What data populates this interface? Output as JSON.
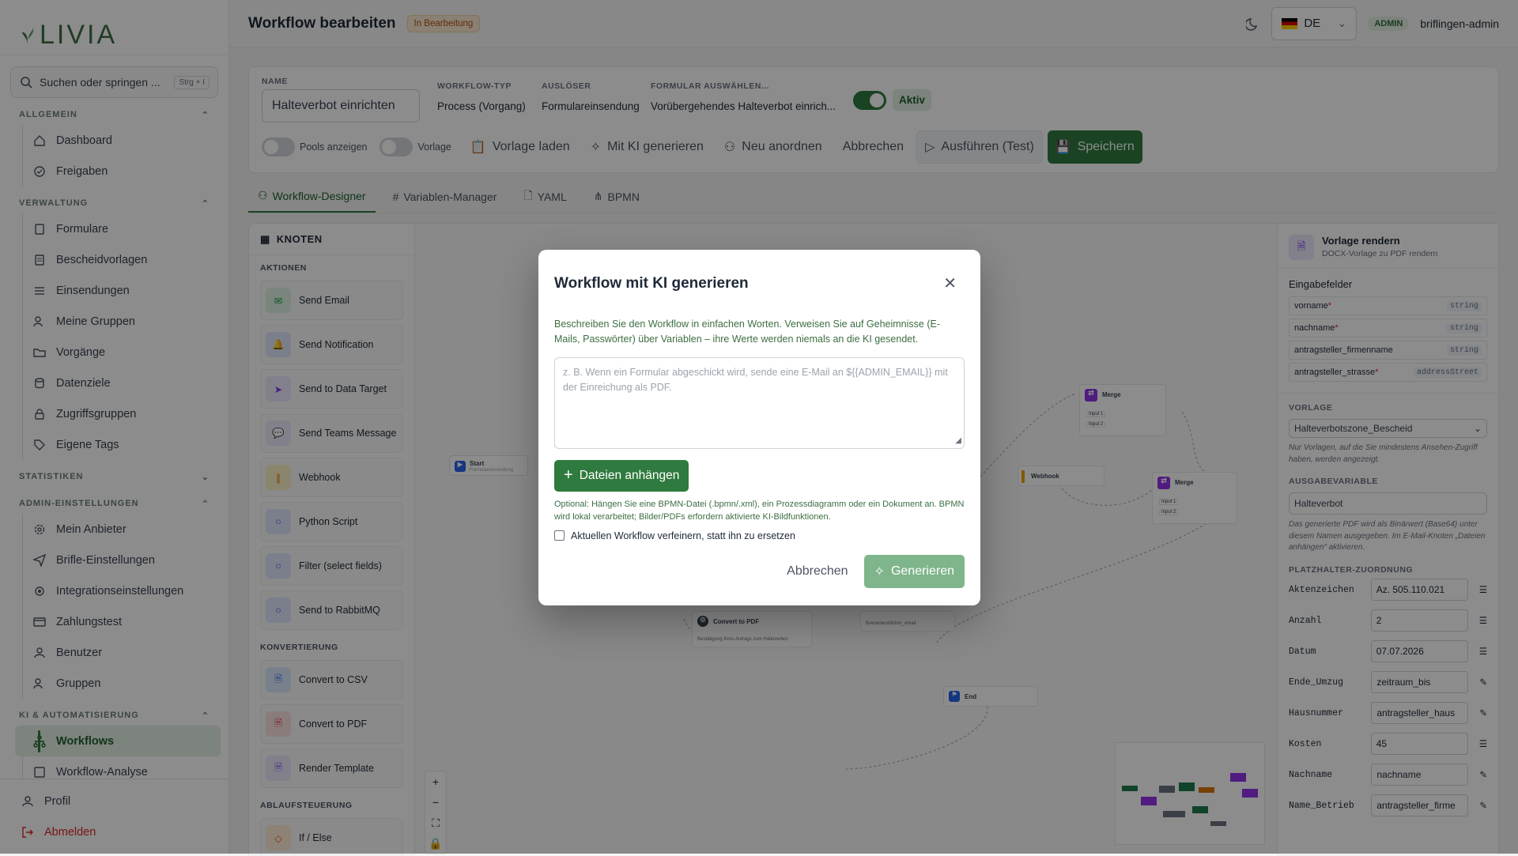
{
  "app": {
    "logo_text": "LIVIA"
  },
  "search": {
    "placeholder": "Suchen oder springen ...",
    "shortcut": "Strg + I"
  },
  "sidebar": {
    "sections": [
      {
        "title": "ALLGEMEIN",
        "items": [
          "Dashboard",
          "Freigaben"
        ]
      },
      {
        "title": "VERWALTUNG",
        "items": [
          "Formulare",
          "Bescheidvorlagen",
          "Einsendungen",
          "Meine Gruppen",
          "Vorgänge",
          "Datenziele",
          "Zugriffsgruppen",
          "Eigene Tags"
        ]
      },
      {
        "title": "STATISTIKEN",
        "items": []
      },
      {
        "title": "ADMIN-EINSTELLUNGEN",
        "items": [
          "Mein Anbieter",
          "Brifle-Einstellungen",
          "Integrationseinstellungen",
          "Zahlungstest",
          "Benutzer",
          "Gruppen"
        ]
      },
      {
        "title": "KI & AUTOMATISIERUNG",
        "items": [
          "Workflows",
          "Workflow-Analyse"
        ]
      }
    ],
    "profile": "Profil",
    "logout": "Abmelden"
  },
  "header": {
    "title": "Workflow bearbeiten",
    "status": "In Bearbeitung",
    "lang": "DE",
    "role": "ADMIN",
    "user": "briflingen-admin"
  },
  "form": {
    "name_label": "NAME",
    "name_value": "Halteverbot einrichten",
    "type_label": "WORKFLOW-TYP",
    "type_value": "Process (Vorgang)",
    "trigger_label": "AUSLÖSER",
    "trigger_value": "Formulareinsendung",
    "form_label": "FORMULAR AUSWÄHLEN...",
    "form_value": "Vorübergehendes Halteverbot einrich...",
    "active_label": "Aktiv",
    "pools_label": "Pools anzeigen",
    "template_label": "Vorlage",
    "btn_load": "Vorlage laden",
    "btn_ai": "Mit KI generieren",
    "btn_arrange": "Neu anordnen",
    "btn_cancel": "Abbrechen",
    "btn_run": "Ausführen (Test)",
    "btn_save": "Speichern"
  },
  "tabs": [
    "Workflow-Designer",
    "Variablen-Manager",
    "YAML",
    "BPMN"
  ],
  "knoten": {
    "title": "KNOTEN",
    "sections": [
      {
        "title": "AKTIONEN",
        "items": [
          "Send Email",
          "Send Notification",
          "Send to Data Target",
          "Send Teams Message",
          "Webhook",
          "Python Script",
          "Filter (select fields)",
          "Send to RabbitMQ"
        ]
      },
      {
        "title": "KONVERTIERUNG",
        "items": [
          "Convert to CSV",
          "Convert to PDF",
          "Render Template"
        ]
      },
      {
        "title": "ABLAUFSTEUERUNG",
        "items": [
          "If / Else"
        ]
      }
    ]
  },
  "canvas": {
    "nodes": {
      "start": "Start",
      "start_sub": "Formulareinsendung",
      "merge": "Merge",
      "input1": "Input 1",
      "input2": "Input 2",
      "webhook": "Webhook",
      "convert_pdf": "Convert to PDF",
      "convert_pdf_sub": "Bestätigung Ihres Antrags zum Halteverbot",
      "email_sub": "$verantwortlicher_email",
      "end": "End"
    }
  },
  "panel": {
    "title": "Vorlage rendern",
    "subtitle": "DOCX-Vorlage zu PDF rendern",
    "input_fields_label": "Eingabefelder",
    "fields": [
      {
        "name": "vorname",
        "required": "*",
        "type": "string"
      },
      {
        "name": "nachname",
        "required": "*",
        "type": "string"
      },
      {
        "name": "antragsteller_firmenname",
        "required": "",
        "type": "string"
      },
      {
        "name": "antragsteller_strasse",
        "required": "*",
        "type": "addressStreet"
      }
    ],
    "vorlage_label": "VORLAGE",
    "vorlage_value": "Halteverbotszone_Bescheid",
    "vorlage_hint": "Nur Vorlagen, auf die Sie mindestens Ansehen-Zugriff haben, werden angezeigt.",
    "output_label": "AUSGABEVARIABLE",
    "output_value": "Halteverbot",
    "output_hint": "Das generierte PDF wird als Binärwert (Base64) unter diesem Namen ausgegeben. Im E-Mail-Knoten „Dateien anhängen“ aktivieren.",
    "mapping_label": "PLATZHALTER-ZUORDNUNG",
    "mappings": [
      {
        "key": "Aktenzeichen",
        "value": "Az. 505.110.021"
      },
      {
        "key": "Anzahl",
        "value": "2"
      },
      {
        "key": "Datum",
        "value": "07.07.2026"
      },
      {
        "key": "Ende_Umzug",
        "value": "zeitraum_bis"
      },
      {
        "key": "Hausnummer",
        "value": "antragsteller_haus"
      },
      {
        "key": "Kosten",
        "value": "45"
      },
      {
        "key": "Nachname",
        "value": "nachname"
      },
      {
        "key": "Name_Betrieb",
        "value": "antragsteller_firme"
      }
    ]
  },
  "modal": {
    "title": "Workflow mit KI generieren",
    "description": "Beschreiben Sie den Workflow in einfachen Worten. Verweisen Sie auf Geheimnisse (E-Mails, Passwörter) über Variablen – ihre Werte werden niemals an die KI gesendet.",
    "placeholder": "z. B. Wenn ein Formular abgeschickt wird, sende eine E-Mail an ${{ADMIN_EMAIL}} mit der Einreichung als PDF.",
    "attach_label": "Dateien anhängen",
    "hint": "Optional: Hängen Sie eine BPMN-Datei (.bpmn/.xml), ein Prozessdiagramm oder ein Dokument an. BPMN wird lokal verarbeitet; Bilder/PDFs erfordern aktivierte KI-Bildfunktionen.",
    "checkbox_label": "Aktuellen Workflow verfeinern, statt ihn zu ersetzen",
    "cancel": "Abbrechen",
    "generate": "Generieren"
  },
  "colors": {
    "accent": "#2f7a3e",
    "accent_light": "#e3eee4",
    "warning": "#b45309",
    "purple": "#7c3aed"
  }
}
